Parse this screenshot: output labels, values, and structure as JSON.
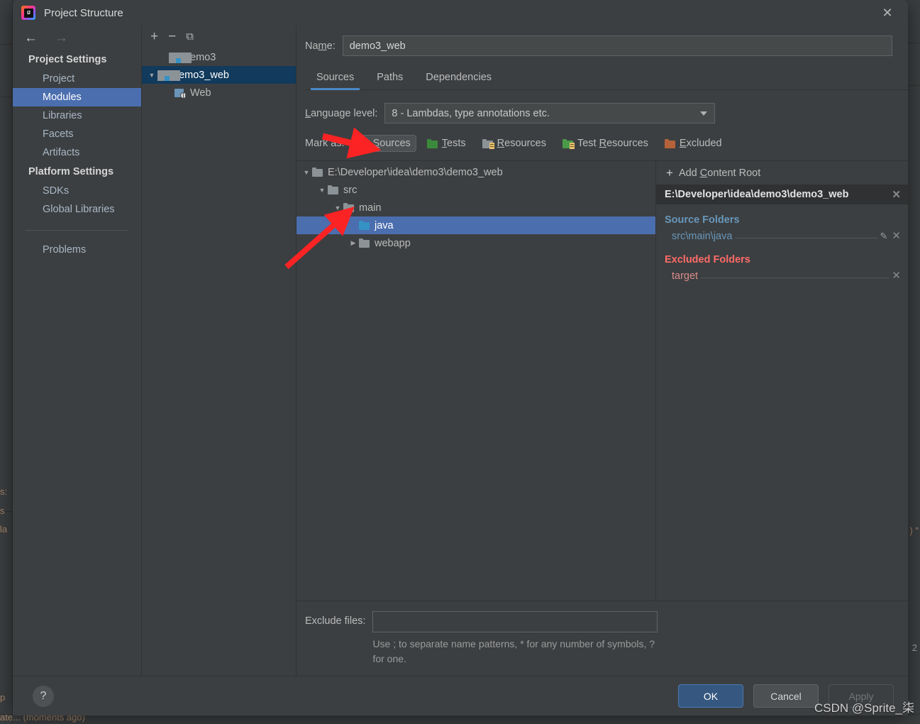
{
  "window": {
    "title": "Project Structure",
    "app_icon": "intellij-idea-icon",
    "close_icon": "✕"
  },
  "nav": {
    "back_icon": "←",
    "forward_icon": "→"
  },
  "sidebar": {
    "groups": [
      {
        "header": "Project Settings",
        "items": [
          {
            "label": "Project",
            "selected": false
          },
          {
            "label": "Modules",
            "selected": true
          },
          {
            "label": "Libraries",
            "selected": false
          },
          {
            "label": "Facets",
            "selected": false
          },
          {
            "label": "Artifacts",
            "selected": false
          }
        ]
      },
      {
        "header": "Platform Settings",
        "items": [
          {
            "label": "SDKs",
            "selected": false
          },
          {
            "label": "Global Libraries",
            "selected": false
          }
        ]
      }
    ],
    "problems_label": "Problems"
  },
  "modules_panel": {
    "toolbar": {
      "add_icon": "+",
      "remove_icon": "−",
      "copy_icon": "⧉"
    },
    "items": [
      {
        "label": "demo3",
        "icon": "module-folder-icon",
        "indent": 0,
        "expander": "",
        "selected": false
      },
      {
        "label": "demo3_web",
        "icon": "module-folder-icon",
        "indent": 0,
        "expander": "▼",
        "selected": true
      },
      {
        "label": "Web",
        "icon": "web-facet-icon",
        "indent": 1,
        "expander": "",
        "selected": false
      }
    ]
  },
  "editor": {
    "name_label": "Name:",
    "name_label_pre": "Na",
    "name_label_mnemonic": "m",
    "name_label_post": "e:",
    "name_value": "demo3_web",
    "name_placeholder": "",
    "tabs": [
      {
        "label": "Sources",
        "active": true
      },
      {
        "label": "Paths",
        "active": false
      },
      {
        "label": "Dependencies",
        "active": false
      }
    ],
    "language_level": {
      "label_pre": "",
      "label_mnemonic": "L",
      "label_post": "anguage level:",
      "value": "8 - Lambdas, type annotations etc.",
      "caret_icon": "chevron-down-icon"
    },
    "mark_as": {
      "label": "Mark as:",
      "buttons": [
        {
          "pre": "",
          "mnemonic": "S",
          "post": "ources",
          "color": "#3592c4",
          "pressed": true,
          "lines": false
        },
        {
          "pre": "",
          "mnemonic": "T",
          "post": "ests",
          "color": "#3b8a3b",
          "pressed": false,
          "lines": false
        },
        {
          "pre": "",
          "mnemonic": "R",
          "post": "esources",
          "color": "#8c9397",
          "pressed": false,
          "lines": true
        },
        {
          "pre": "Test ",
          "mnemonic": "R",
          "post": "esources",
          "color": "#4a9a4a",
          "pressed": false,
          "lines": true
        },
        {
          "pre": "",
          "mnemonic": "E",
          "post": "xcluded",
          "color": "#b5623a",
          "pressed": false,
          "lines": false
        }
      ]
    },
    "tree": [
      {
        "label": "E:\\Developer\\idea\\demo3\\demo3_web",
        "expander": "▼",
        "indent": 0,
        "kind": "plain",
        "selected": false
      },
      {
        "label": "src",
        "expander": "▼",
        "indent": 1,
        "kind": "plain",
        "selected": false
      },
      {
        "label": "main",
        "expander": "▼",
        "indent": 2,
        "kind": "plain",
        "selected": false
      },
      {
        "label": "java",
        "expander": "",
        "indent": 3,
        "kind": "source",
        "selected": true
      },
      {
        "label": "webapp",
        "expander": "▶",
        "indent": 2,
        "kind": "plain",
        "selected": false
      }
    ],
    "exclude": {
      "label": "Exclude files:",
      "value": "",
      "placeholder": "",
      "hint": "Use ; to separate name patterns, * for any number of symbols, ? for one."
    }
  },
  "right_panel": {
    "add_content_root": {
      "plus_icon": "+",
      "pre": "Add ",
      "mnemonic": "C",
      "post": "ontent Root"
    },
    "content_root_path": "E:\\Developer\\idea\\demo3\\demo3_web",
    "remove_icon": "✕",
    "groups": [
      {
        "title": "Source Folders",
        "kind": "src",
        "folders": [
          {
            "name": "src\\main\\java",
            "has_edit": true
          }
        ]
      },
      {
        "title": "Excluded Folders",
        "kind": "exc",
        "folders": [
          {
            "name": "target",
            "has_edit": false
          }
        ]
      }
    ],
    "edit_icon": "✎"
  },
  "footer": {
    "help_icon": "?",
    "buttons": [
      {
        "label": "OK",
        "style": "primary"
      },
      {
        "label": "Cancel",
        "style": "normal"
      },
      {
        "label": "Apply",
        "style": "disabled"
      }
    ]
  },
  "annotations": {
    "arrow_color": "#fb2323",
    "arrow_1_name": "arrow-pointing-to-sources-button",
    "arrow_2_name": "arrow-pointing-to-java-folder"
  },
  "watermark": "CSDN @Sprite_柒",
  "background": {
    "left_fragments": [
      "s:",
      "s",
      "la",
      "p",
      "ate... (moments ago)"
    ],
    "right_fragments": [
      ") \"",
      "2"
    ]
  }
}
